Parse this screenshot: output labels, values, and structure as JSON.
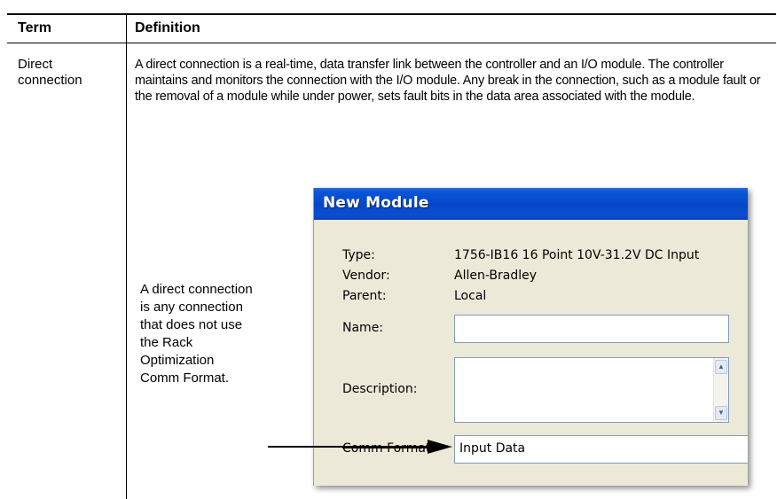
{
  "table": {
    "header_term": "Term",
    "header_definition": "Definition",
    "term": "Direct connection",
    "definition": "A direct connection is a real-time, data transfer link between the controller and an I/O module. The controller maintains and monitors the connection with the I/O module. Any break in the connection, such as a module fault or the removal of a module while under power, sets fault bits in the data area associated with the module."
  },
  "callout": {
    "lines": [
      "A direct connection",
      "is any connection",
      "that does not use",
      "the Rack",
      "Optimization",
      "Comm Format."
    ]
  },
  "dialog": {
    "title": "New Module",
    "type_label": "Type:",
    "type_value": "1756-IB16 16 Point 10V-31.2V DC Input",
    "vendor_label": "Vendor:",
    "vendor_value": "Allen-Bradley",
    "parent_label": "Parent:",
    "parent_value": "Local",
    "name_label": "Name:",
    "name_value": "",
    "description_label": "Description:",
    "comm_format_label": "Comm Format:",
    "comm_format_value": "Input Data"
  }
}
